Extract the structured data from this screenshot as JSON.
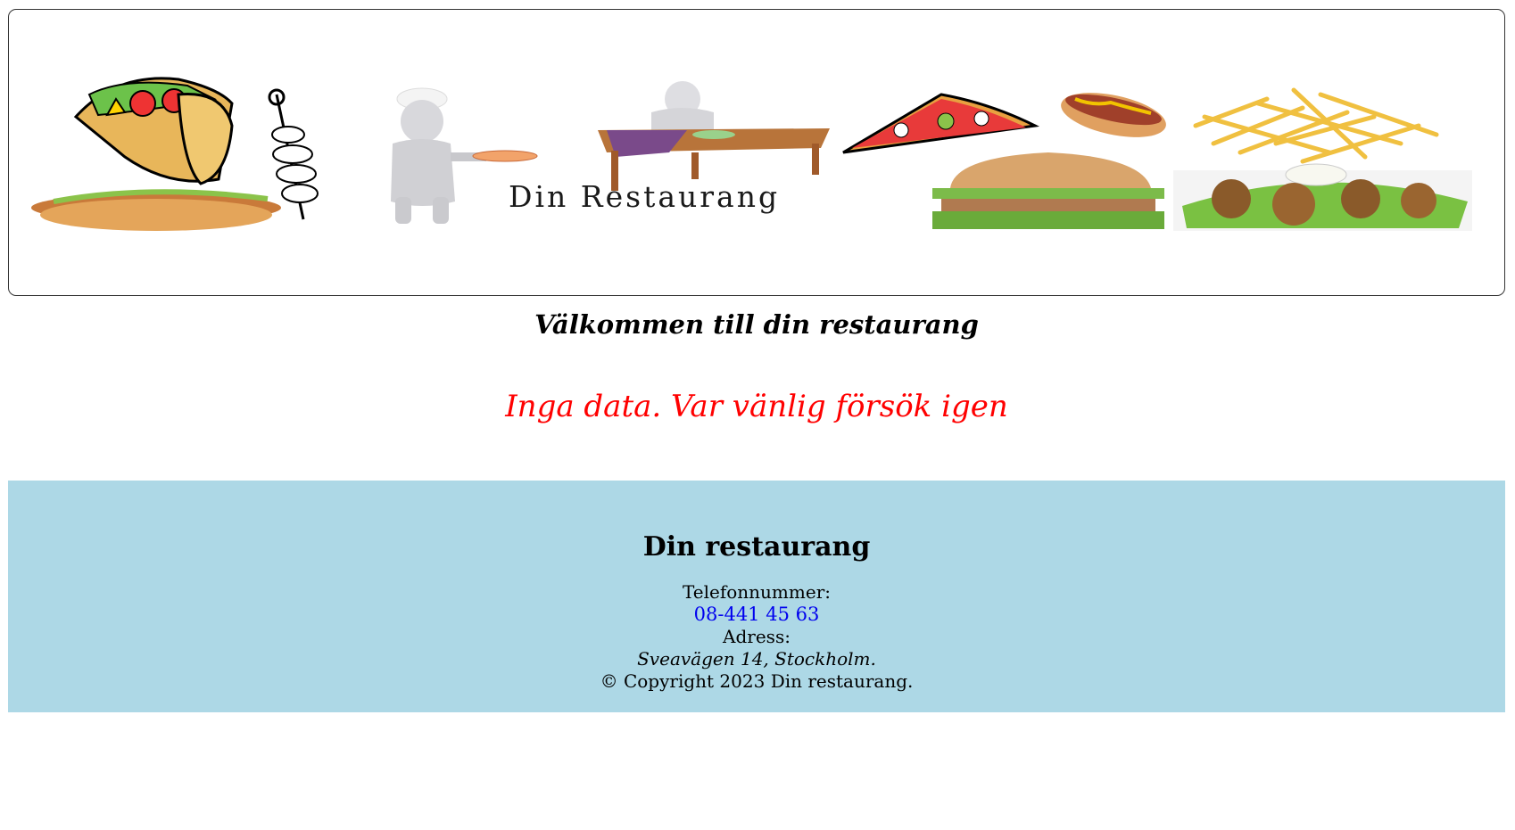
{
  "banner": {
    "title": "Din Restaurang",
    "illustrations": [
      "kebab-wrap",
      "hot-dog",
      "skewer",
      "chef-with-pizza",
      "diner-at-table",
      "pizza-slice",
      "hot-dog-mustard",
      "hamburger",
      "french-fries",
      "falafel-plate"
    ]
  },
  "main": {
    "welcome": "Välkommen till din restaurang",
    "error_message": "Inga data. Var vänlig försök igen"
  },
  "footer": {
    "title": "Din restaurang",
    "phone_label": "Telefonnummer:",
    "phone": "08-441 45 63",
    "address_label": "Adress:",
    "address": "Sveavägen 14, Stockholm.",
    "copyright": "© Copyright 2023 Din restaurang."
  },
  "colors": {
    "footer_bg": "#add8e6",
    "error": "#ff0000",
    "link": "#0000ee"
  }
}
